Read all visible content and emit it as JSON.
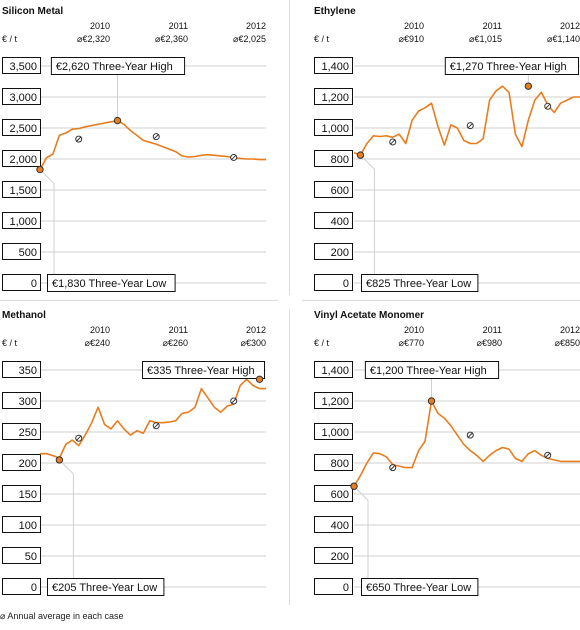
{
  "footnote": "⌀ Annual average in each case",
  "chart_data": [
    {
      "type": "line",
      "title": "Silicon Metal",
      "unit": "€ / t",
      "years": [
        "2010",
        "2011",
        "2012"
      ],
      "annual_averages": [
        "⌀€2,320",
        "⌀€2,360",
        "⌀€2,025"
      ],
      "annual_average_values": [
        2320,
        2360,
        2025
      ],
      "yticks": [
        0,
        500,
        1000,
        1500,
        2000,
        2500,
        3000,
        3500
      ],
      "ytick_labels": [
        "0",
        "500",
        "1,000",
        "1,500",
        "2,000",
        "2,500",
        "3,000",
        "3,500"
      ],
      "ylim": [
        0,
        3500
      ],
      "high_label": "€2,620 Three-Year High",
      "high_value": 2620,
      "high_index": 12,
      "low_label": "€1,830 Three-Year Low",
      "low_value": 1830,
      "low_index": 0,
      "values": [
        1830,
        2020,
        2080,
        2380,
        2420,
        2480,
        2490,
        2520,
        2540,
        2560,
        2580,
        2600,
        2620,
        2560,
        2460,
        2380,
        2300,
        2270,
        2240,
        2200,
        2160,
        2120,
        2050,
        2030,
        2040,
        2060,
        2070,
        2060,
        2050,
        2040,
        2020,
        2010,
        2000,
        2000,
        1990,
        1990
      ]
    },
    {
      "type": "line",
      "title": "Ethylene",
      "unit": "€ / t",
      "years": [
        "2010",
        "2011",
        "2012"
      ],
      "annual_averages": [
        "⌀€910",
        "⌀€1,015",
        "⌀€1,140"
      ],
      "annual_average_values": [
        910,
        1015,
        1140
      ],
      "yticks": [
        0,
        200,
        400,
        600,
        800,
        1000,
        1200,
        1400
      ],
      "ytick_labels": [
        "0",
        "200",
        "400",
        "600",
        "800",
        "1,000",
        "1,200",
        "1,400"
      ],
      "ylim": [
        0,
        1400
      ],
      "high_label": "€1,270 Three-Year High",
      "high_value": 1270,
      "high_index": 27,
      "low_label": "€825 Three-Year Low",
      "low_value": 825,
      "low_index": 1,
      "values": [
        840,
        825,
        900,
        950,
        945,
        950,
        940,
        960,
        900,
        1050,
        1110,
        1130,
        1160,
        1010,
        890,
        1020,
        1000,
        920,
        900,
        900,
        930,
        1180,
        1240,
        1270,
        1230,
        960,
        880,
        1050,
        1180,
        1230,
        1150,
        1100,
        1160,
        1180,
        1200,
        1200
      ]
    },
    {
      "type": "line",
      "title": "Methanol",
      "unit": "€ / t",
      "years": [
        "2010",
        "2011",
        "2012"
      ],
      "annual_averages": [
        "⌀€240",
        "⌀€260",
        "⌀€300"
      ],
      "annual_average_values": [
        240,
        260,
        300
      ],
      "yticks": [
        0,
        50,
        100,
        150,
        200,
        250,
        300,
        350
      ],
      "ytick_labels": [
        "0",
        "50",
        "100",
        "150",
        "200",
        "250",
        "300",
        "350"
      ],
      "ylim": [
        0,
        350
      ],
      "high_label": "€335 Three-Year High",
      "high_value": 335,
      "high_index": 34,
      "low_label": "€205 Three-Year Low",
      "low_value": 205,
      "low_index": 3,
      "values": [
        215,
        215,
        212,
        208,
        230,
        237,
        228,
        245,
        265,
        290,
        262,
        255,
        268,
        255,
        245,
        252,
        248,
        268,
        265,
        265,
        266,
        268,
        280,
        282,
        290,
        320,
        305,
        290,
        282,
        292,
        295,
        325,
        335,
        325,
        320,
        320
      ]
    },
    {
      "type": "line",
      "title": "Vinyl Acetate Monomer",
      "unit": "€ / t",
      "years": [
        "2010",
        "2011",
        "2012"
      ],
      "annual_averages": [
        "⌀€770",
        "⌀€980",
        "⌀€850"
      ],
      "annual_average_values": [
        770,
        980,
        850
      ],
      "yticks": [
        0,
        200,
        400,
        600,
        800,
        1000,
        1200,
        1400
      ],
      "ytick_labels": [
        "0",
        "200",
        "400",
        "600",
        "800",
        "1,000",
        "1,200",
        "1,400"
      ],
      "ylim": [
        0,
        1400
      ],
      "high_label": "€1,200 Three-Year High",
      "high_value": 1200,
      "high_index": 12,
      "low_label": "€650 Three-Year Low",
      "low_value": 650,
      "low_index": 0,
      "values": [
        650,
        720,
        800,
        865,
        860,
        840,
        790,
        780,
        770,
        770,
        880,
        940,
        1200,
        1120,
        1090,
        1040,
        980,
        920,
        880,
        850,
        810,
        850,
        880,
        900,
        890,
        830,
        810,
        860,
        880,
        850,
        830,
        820,
        810,
        810,
        810,
        810
      ]
    }
  ]
}
